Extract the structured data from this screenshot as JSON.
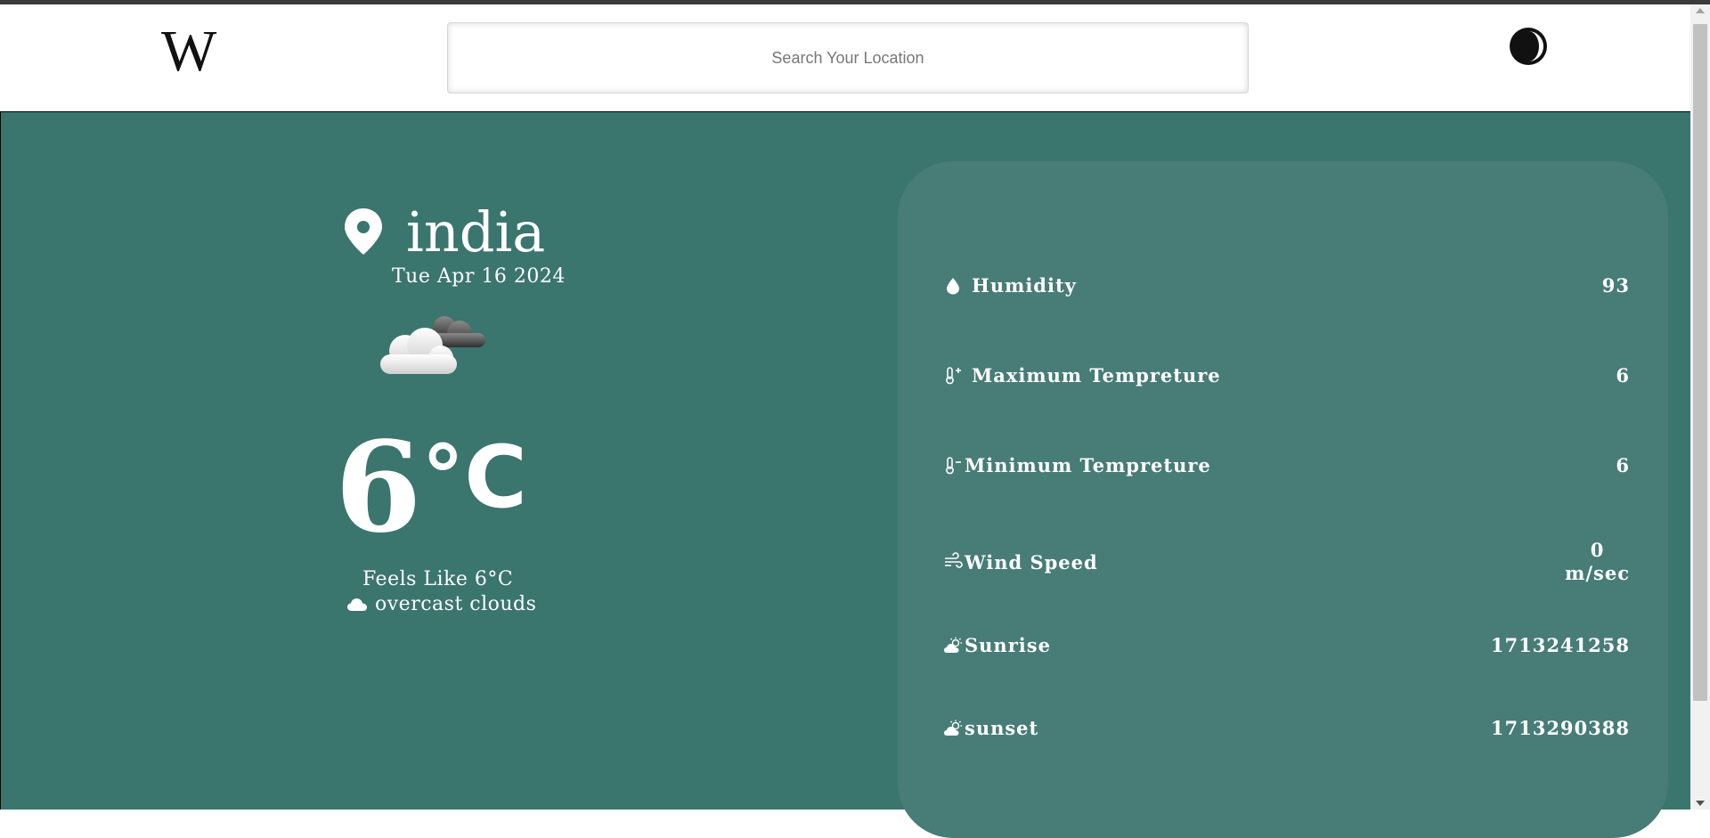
{
  "header": {
    "logo_text": "W",
    "search": {
      "placeholder": "Search Your Location",
      "value": ""
    },
    "theme_toggle": "moon-icon"
  },
  "current": {
    "location": "india",
    "date": "Tue Apr 16 2024",
    "weather_icon": "cloudy-icon",
    "temperature": "6",
    "unit": "°C",
    "feels_like": "Feels Like 6°C",
    "description": "overcast clouds"
  },
  "details": [
    {
      "icon": "droplet-icon",
      "label": "Humidity",
      "value": "93"
    },
    {
      "icon": "thermometer-plus-icon",
      "label": "Maximum Tempreture",
      "value": "6"
    },
    {
      "icon": "thermometer-minus-icon",
      "label": "Minimum Tempreture",
      "value": "6"
    },
    {
      "icon": "wind-icon",
      "label": "Wind Speed",
      "value": "0",
      "unit": "m/sec"
    },
    {
      "icon": "sunrise-icon",
      "label": "Sunrise",
      "value": "1713241258"
    },
    {
      "icon": "sunset-icon",
      "label": "sunset",
      "value": "1713290388"
    }
  ],
  "colors": {
    "background": "#3a756e",
    "card": "#477c77",
    "text": "#ffffff"
  }
}
